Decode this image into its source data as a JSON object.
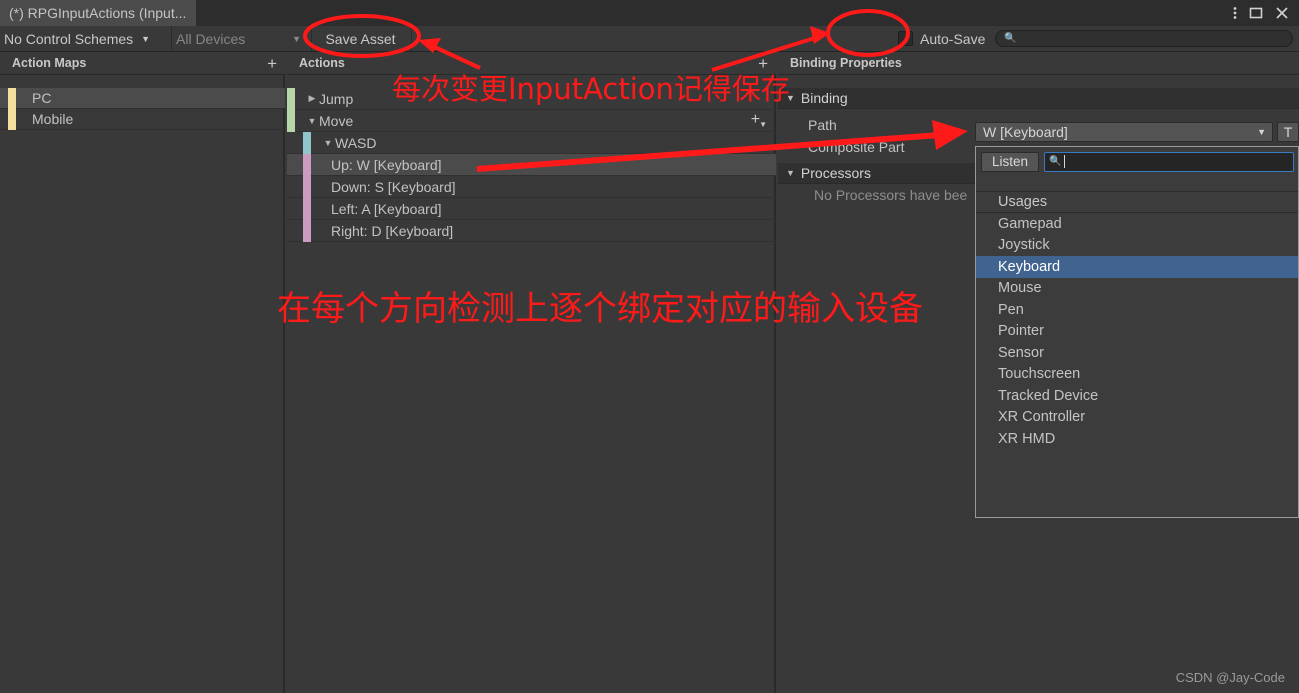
{
  "window": {
    "tab_title": "(*) RPGInputActions (Input...",
    "menu_icon": "kebab-menu-icon",
    "maximize_icon": "maximize-icon",
    "close_icon": "close-icon"
  },
  "toolbar": {
    "control_schemes": "No Control Schemes",
    "devices": "All Devices",
    "save_asset": "Save Asset",
    "autosave_label": "Auto-Save",
    "autosave_checked": false,
    "search_value": "",
    "search_placeholder": ""
  },
  "action_maps": {
    "header": "Action Maps",
    "add_label": "+",
    "items": [
      {
        "label": "PC",
        "selected": true,
        "strip_color": "#f3e0a0"
      },
      {
        "label": "Mobile",
        "selected": false,
        "strip_color": "#f3e0a0"
      }
    ]
  },
  "actions": {
    "header": "Actions",
    "add_label": "+",
    "rows": [
      {
        "label": "Jump",
        "indent": 0,
        "triangle": "▶",
        "strip_color": "#b6d6a7",
        "selected": false,
        "has_plus": false
      },
      {
        "label": "Move",
        "indent": 0,
        "triangle": "▼",
        "strip_color": "#b6d6a7",
        "selected": false,
        "has_plus": true
      },
      {
        "label": "WASD",
        "indent": 1,
        "triangle": "▼",
        "strip_color": "#8fc5cb",
        "selected": false,
        "has_plus": false
      },
      {
        "label": "Up: W [Keyboard]",
        "indent": 2,
        "triangle": "",
        "strip_color": "#cc9cc0",
        "selected": true,
        "has_plus": false
      },
      {
        "label": "Down: S [Keyboard]",
        "indent": 2,
        "triangle": "",
        "strip_color": "#cc9cc0",
        "selected": false,
        "has_plus": false
      },
      {
        "label": "Left: A [Keyboard]",
        "indent": 2,
        "triangle": "",
        "strip_color": "#cc9cc0",
        "selected": false,
        "has_plus": false
      },
      {
        "label": "Right: D [Keyboard]",
        "indent": 2,
        "triangle": "",
        "strip_color": "#cc9cc0",
        "selected": false,
        "has_plus": false
      }
    ]
  },
  "binding_properties": {
    "header": "Binding Properties",
    "binding_foldout": "Binding",
    "path_label": "Path",
    "path_value": "W [Keyboard]",
    "path_t_button": "T",
    "composite_part_label": "Composite Part",
    "processors_foldout": "Processors",
    "processors_note": "No Processors have bee"
  },
  "path_popup": {
    "listen_button": "Listen",
    "search_value": "",
    "section_header": "Usages",
    "items": [
      {
        "label": "Gamepad",
        "selected": false
      },
      {
        "label": "Joystick",
        "selected": false
      },
      {
        "label": "Keyboard",
        "selected": true
      },
      {
        "label": "Mouse",
        "selected": false
      },
      {
        "label": "Pen",
        "selected": false
      },
      {
        "label": "Pointer",
        "selected": false
      },
      {
        "label": "Sensor",
        "selected": false
      },
      {
        "label": "Touchscreen",
        "selected": false
      },
      {
        "label": "Tracked Device",
        "selected": false
      },
      {
        "label": "XR Controller",
        "selected": false
      },
      {
        "label": "XR HMD",
        "selected": false
      }
    ]
  },
  "annotations": {
    "color": "#ff1a1a",
    "note_save": "每次变更InputAction记得保存",
    "note_bind": "在每个方向检测上逐个绑定对应的输入设备"
  },
  "watermark": "CSDN @Jay-Code"
}
